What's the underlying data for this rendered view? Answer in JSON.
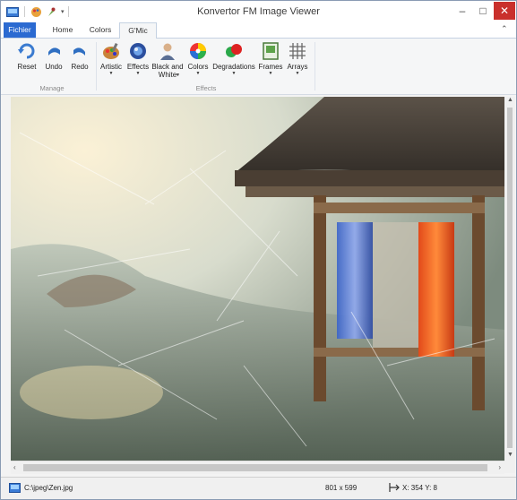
{
  "window": {
    "title": "Konvertor FM Image Viewer",
    "minimize_glyph": "–",
    "maximize_glyph": "□",
    "close_glyph": "✕"
  },
  "tabs": [
    "Fichier",
    "Home",
    "Colors",
    "G'Mic"
  ],
  "active_tab": "G'Mic",
  "ribbon": {
    "manage": {
      "group_label": "Manage",
      "buttons": [
        "Reset",
        "Undo",
        "Redo"
      ]
    },
    "effects": {
      "group_label": "Effects",
      "buttons": [
        {
          "label": "Artistic",
          "has_menu": true
        },
        {
          "label": "Effects",
          "has_menu": true
        },
        {
          "label": "Black and White",
          "has_menu": true
        },
        {
          "label": "Colors",
          "has_menu": true
        },
        {
          "label": "Degradations",
          "has_menu": true
        },
        {
          "label": "Frames",
          "has_menu": true
        },
        {
          "label": "Arrays",
          "has_menu": true
        }
      ]
    }
  },
  "status": {
    "path": "C:\\jpeg\\Zen.jpg",
    "dimensions": "801 x 599",
    "coords": "X: 354  Y: 8"
  },
  "colors": {
    "accent": "#2b6ad1",
    "close": "#c9302c"
  }
}
